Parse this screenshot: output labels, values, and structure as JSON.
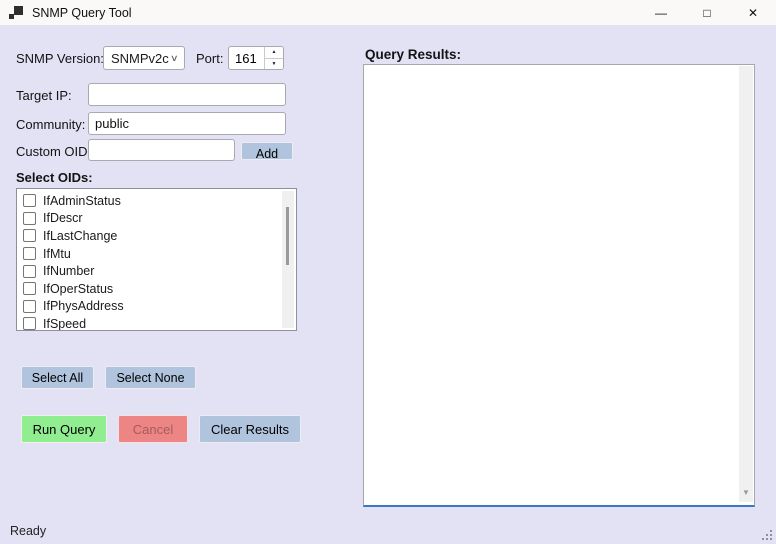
{
  "window": {
    "title": "SNMP Query Tool"
  },
  "icons": {
    "app_icon": "overlapping-squares",
    "minimize": "—",
    "maximize": "□",
    "close": "✕",
    "combo_chevron": "∨",
    "spinner_up": "▲",
    "spinner_down": "▼",
    "scroll_down": "▼"
  },
  "form": {
    "snmp_version": {
      "label": "SNMP Version:",
      "value": "SNMPv2c"
    },
    "port": {
      "label": "Port:",
      "value": "161"
    },
    "target_ip": {
      "label": "Target IP:",
      "value": "",
      "placeholder": ""
    },
    "community": {
      "label": "Community:",
      "value": "public"
    },
    "custom_oid": {
      "label": "Custom OID:",
      "value": "",
      "add_button": "Add"
    },
    "select_oids_label": "Select OIDs:",
    "oids": [
      {
        "label": "IfAdminStatus",
        "checked": false
      },
      {
        "label": "IfDescr",
        "checked": false
      },
      {
        "label": "IfLastChange",
        "checked": false
      },
      {
        "label": "IfMtu",
        "checked": false
      },
      {
        "label": "IfNumber",
        "checked": false
      },
      {
        "label": "IfOperStatus",
        "checked": false
      },
      {
        "label": "IfPhysAddress",
        "checked": false
      },
      {
        "label": "IfSpeed",
        "checked": false
      }
    ]
  },
  "buttons": {
    "select_all": "Select All",
    "select_none": "Select None",
    "run_query": "Run Query",
    "cancel": "Cancel",
    "clear_results": "Clear Results"
  },
  "results": {
    "label": "Query Results:",
    "content": ""
  },
  "status": {
    "text": "Ready"
  },
  "colors": {
    "background": "#E2E2F4",
    "titlebar": "#FAF9F8",
    "steel_button": "#B0C4DE",
    "green_button": "#90EE90",
    "coral_button": "#ED8585",
    "coral_text": "#A35C5C",
    "focus_blue": "#3879C5",
    "field_border": "#A9A9B0"
  }
}
